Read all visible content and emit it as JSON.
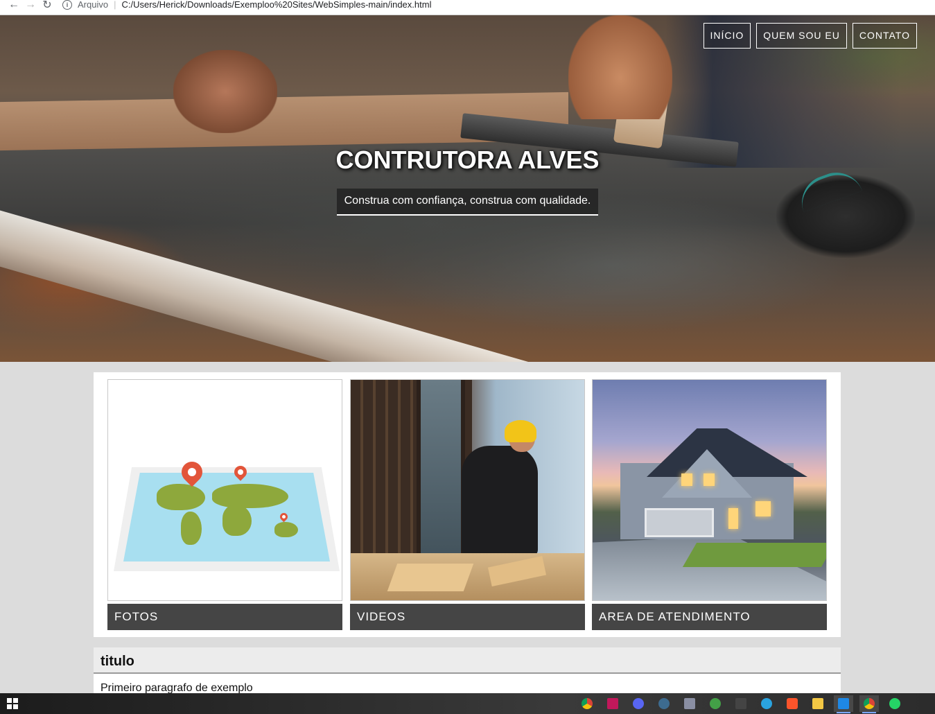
{
  "browser": {
    "url_label": "Arquivo",
    "url_separator": "|",
    "url": "C:/Users/Herick/Downloads/Exemploo%20Sites/WebSimples-main/index.html"
  },
  "nav": {
    "items": [
      {
        "label": "INÍCIO"
      },
      {
        "label": "QUEM SOU EU"
      },
      {
        "label": "CONTATO"
      }
    ]
  },
  "hero": {
    "title": "CONTRUTORA ALVES",
    "subtitle": "Construa com confiança, construa com qualidade."
  },
  "cards": [
    {
      "caption": "FOTOS",
      "image": "world-map-with-pins"
    },
    {
      "caption": "VIDEOS",
      "image": "construction-worker-drilling"
    },
    {
      "caption": "AREA DE ATENDIMENTO",
      "image": "house-exterior-at-dusk"
    }
  ],
  "article": {
    "title": "titulo",
    "paragraph": "Primeiro paragrafo de exemplo"
  },
  "taskbar": {
    "icons": [
      "chrome-icon",
      "app-icon",
      "discord-icon",
      "steam-icon",
      "app-icon",
      "app-icon",
      "epic-games-icon",
      "telegram-icon",
      "brave-icon",
      "file-explorer-icon",
      "vscode-icon",
      "chrome-icon",
      "whatsapp-icon"
    ]
  },
  "colors": {
    "page_bg": "#dcdcdc",
    "caption_bg": "#454545",
    "accent_pin": "#e2553a"
  }
}
